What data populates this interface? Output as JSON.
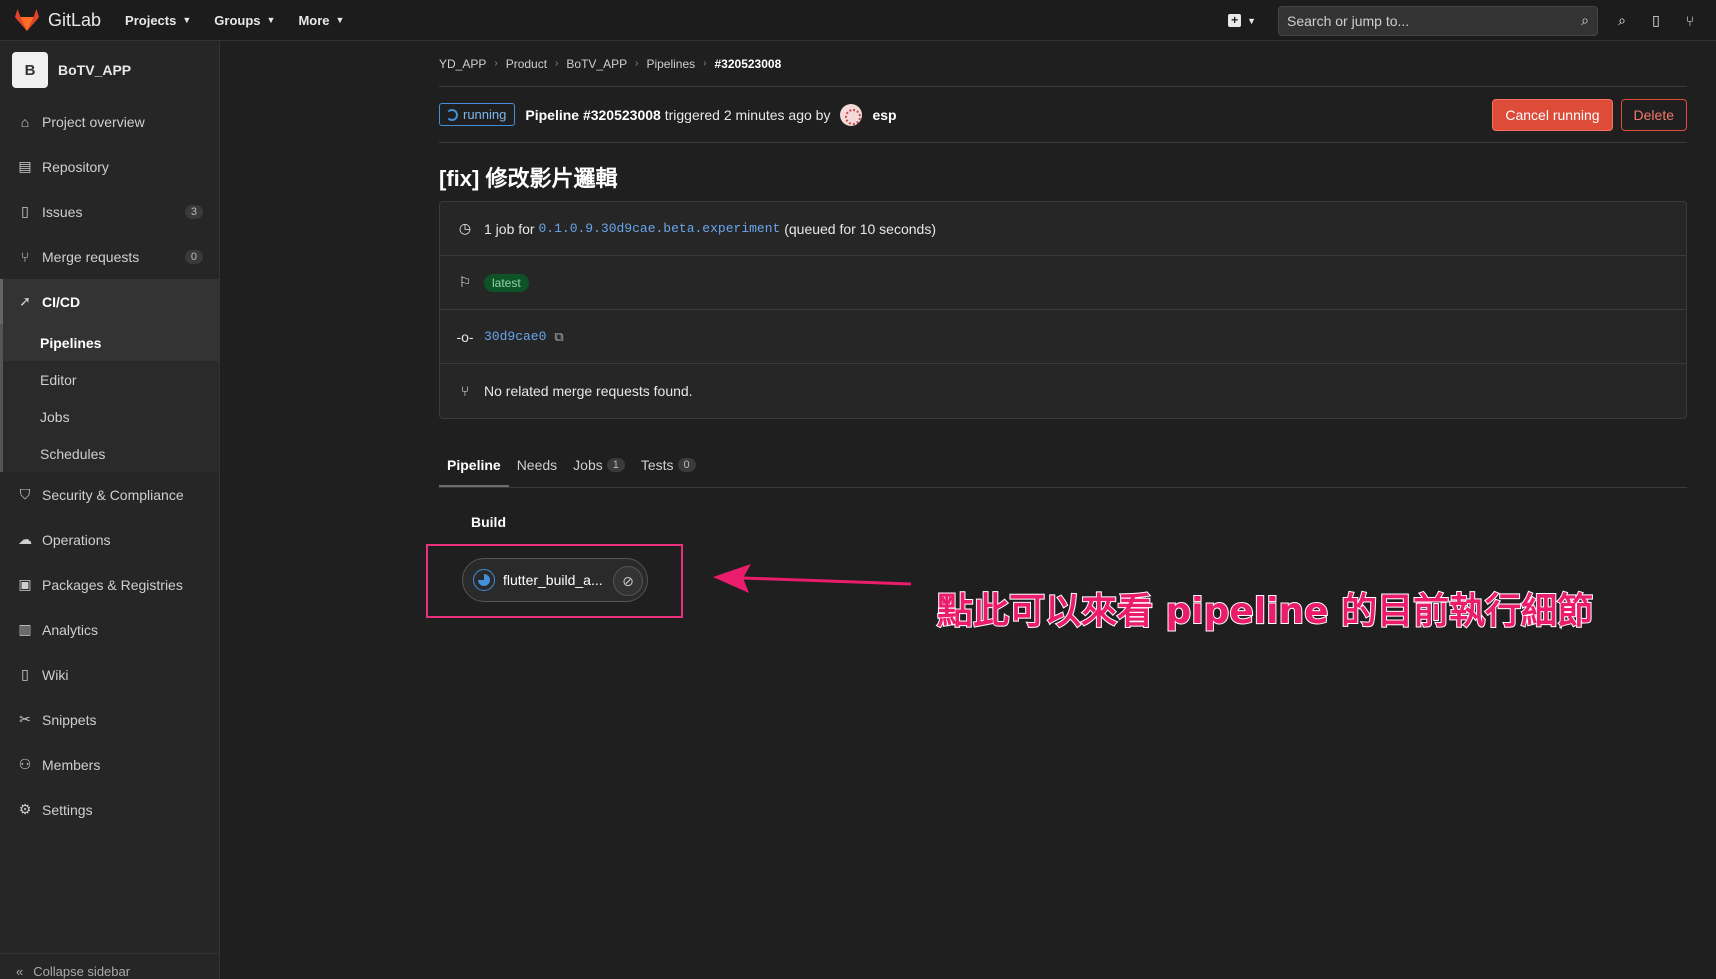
{
  "topbar": {
    "brand": "GitLab",
    "nav": [
      {
        "label": "Projects"
      },
      {
        "label": "Groups"
      },
      {
        "label": "More"
      }
    ],
    "search_placeholder": "Search or jump to..."
  },
  "sidebar": {
    "project_initial": "B",
    "project_name": "BoTV_APP",
    "items": [
      {
        "label": "Project overview",
        "icon": "home-icon"
      },
      {
        "label": "Repository",
        "icon": "doc-icon"
      },
      {
        "label": "Issues",
        "icon": "issues-icon",
        "count": "3"
      },
      {
        "label": "Merge requests",
        "icon": "merge-request-icon",
        "count": "0"
      },
      {
        "label": "CI/CD",
        "icon": "rocket-icon"
      },
      {
        "label": "Security & Compliance",
        "icon": "shield-icon"
      },
      {
        "label": "Operations",
        "icon": "cloud-icon"
      },
      {
        "label": "Packages & Registries",
        "icon": "package-icon"
      },
      {
        "label": "Analytics",
        "icon": "chart-icon"
      },
      {
        "label": "Wiki",
        "icon": "book-icon"
      },
      {
        "label": "Snippets",
        "icon": "scissors-icon"
      },
      {
        "label": "Members",
        "icon": "users-icon"
      },
      {
        "label": "Settings",
        "icon": "gear-icon"
      }
    ],
    "cicd_sub": [
      "Pipelines",
      "Editor",
      "Jobs",
      "Schedules"
    ],
    "collapse_label": "Collapse sidebar"
  },
  "breadcrumbs": [
    "YD_APP",
    "Product",
    "BoTV_APP",
    "Pipelines",
    "#320523008"
  ],
  "header": {
    "status": "running",
    "pipeline": "Pipeline #320523008",
    "triggered": "triggered 2 minutes ago by",
    "user": "esp",
    "cancel_label": "Cancel running",
    "delete_label": "Delete"
  },
  "title": "[fix] 修改影片邏輯",
  "info": {
    "job_prefix": "1 job for",
    "ref": "0.1.0.9.30d9cae.beta.experiment",
    "queued": "(queued for 10 seconds)",
    "tag": "latest",
    "commit": "30d9cae0",
    "mr_text": "No related merge requests found."
  },
  "tabs": [
    {
      "label": "Pipeline"
    },
    {
      "label": "Needs"
    },
    {
      "label": "Jobs",
      "count": "1"
    },
    {
      "label": "Tests",
      "count": "0"
    }
  ],
  "stage": {
    "title": "Build",
    "job_name": "flutter_build_a..."
  },
  "annotation": "點此可以來看 pipeline 的目前執行細節",
  "colors": {
    "accent": "#428fdc",
    "danger": "#dd4b39",
    "annotation": "#ec1c6c"
  }
}
